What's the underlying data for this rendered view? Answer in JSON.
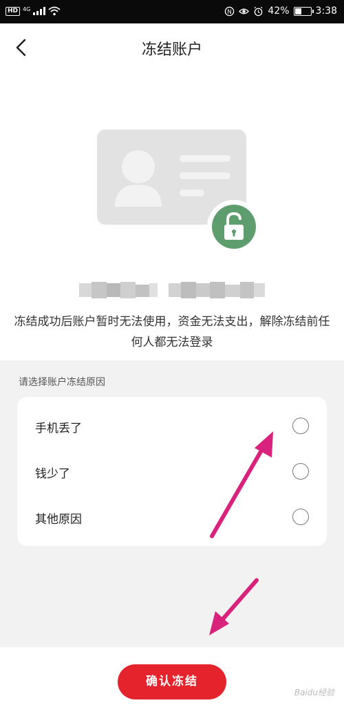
{
  "status_bar": {
    "hd": "HD",
    "network": "4G",
    "battery_percent": "42%",
    "battery_level": 0.42,
    "time": "3:38"
  },
  "header": {
    "title": "冻结账户",
    "back_icon": "chevron-left-icon"
  },
  "illustration": {
    "card_icon": "id-card-icon",
    "badge_icon": "unlock-icon",
    "badge_color": "#5e9e6e"
  },
  "description": "冻结成功后账户暂时无法使用，资金无法支出，解除冻结前任何人都无法登录",
  "reasons": {
    "label": "请选择账户冻结原因",
    "items": [
      {
        "label": "手机丢了",
        "selected": false
      },
      {
        "label": "钱少了",
        "selected": false
      },
      {
        "label": "其他原因",
        "selected": false
      }
    ]
  },
  "confirm_label": "确认冻结",
  "accent_color": "#e5232d",
  "annotation_color": "#d9227c",
  "watermark": "Baidu经验"
}
